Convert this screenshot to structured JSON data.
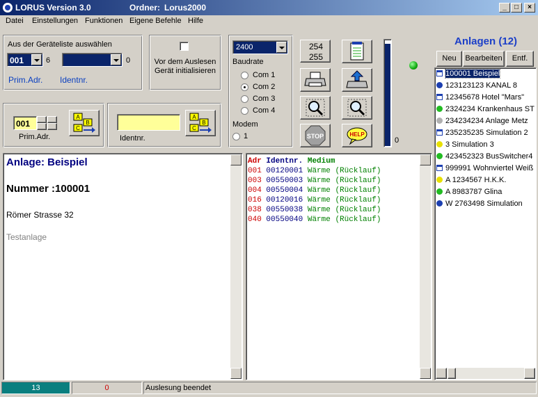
{
  "window": {
    "title": "LORUS Version 3.0",
    "ordner_label": "Ordner:",
    "ordner_value": "Lorus2000"
  },
  "menu": [
    "Datei",
    "Einstellungen",
    "Funktionen",
    "Eigene Befehle",
    "Hilfe"
  ],
  "device_select": {
    "label": "Aus der Geräteliste auswählen",
    "prim_value": "001",
    "prim_count": "6",
    "ident_value": "",
    "ident_count": "0",
    "prim_caption": "Prim.Adr.",
    "ident_caption": "Identnr."
  },
  "init_box": {
    "label": "Vor dem Auslesen Gerät initialisieren",
    "checked": false
  },
  "baud": {
    "value": "2400",
    "label": "Baudrate",
    "ports": [
      "Com 1",
      "Com 2",
      "Com 3",
      "Com 4"
    ],
    "selected_port": "Com 2",
    "modem_label": "Modem",
    "modem_option": "1"
  },
  "address_buttons": {
    "b254": "254",
    "b255": "255"
  },
  "progress": {
    "value": "0",
    "fraction": 0.97
  },
  "prim_entry": {
    "value": "001",
    "caption": "Prim.Adr."
  },
  "ident_entry": {
    "value": "",
    "caption": "Identnr."
  },
  "anlagen": {
    "title": "Anlagen (12)",
    "buttons": [
      "Neu",
      "Bearbeiten",
      "Entf."
    ],
    "items": [
      {
        "icon": "building",
        "color": "#1c3fb0",
        "text": "100001  Beispiel",
        "selected": true
      },
      {
        "icon": "dot",
        "color": "#1c3fb0",
        "text": "123123123  KANAL 8"
      },
      {
        "icon": "building",
        "color": "#1c3fb0",
        "text": "12345678  Hotel \"Mars\""
      },
      {
        "icon": "dot",
        "color": "#22bb22",
        "text": "2324234  Krankenhaus ST"
      },
      {
        "icon": "dot",
        "color": "#b0b0b0",
        "text": "234234234  Anlage Metz"
      },
      {
        "icon": "building",
        "color": "#1c3fb0",
        "text": "235235235  Simulation 2"
      },
      {
        "icon": "dot",
        "color": "#e8e000",
        "text": "3  Simulation 3"
      },
      {
        "icon": "dot",
        "color": "#22bb22",
        "text": "423452323  BusSwitcher4"
      },
      {
        "icon": "building",
        "color": "#1c3fb0",
        "text": "999991  Wohnviertel Weiß"
      },
      {
        "icon": "dot",
        "color": "#e8e000",
        "text": "A 1234567  H.K.K."
      },
      {
        "icon": "dot",
        "color": "#22bb22",
        "text": "A 8983787  Glina"
      },
      {
        "icon": "dot",
        "color": "#1c3fb0",
        "text": "W 2763498  Simulation"
      }
    ]
  },
  "info": {
    "anlage": "Anlage: Beispiel",
    "nummer": "Nummer :100001",
    "strasse": "Römer Strasse 32",
    "beschreibung": "Testanlage"
  },
  "devices": {
    "headers": {
      "adr": "Adr",
      "ident": "Identnr.",
      "medium": "Medium"
    },
    "rows": [
      {
        "adr": "001",
        "ident": "00120001",
        "medium": "Wärme (Rücklauf)"
      },
      {
        "adr": "003",
        "ident": "00550003",
        "medium": "Wärme (Rücklauf)"
      },
      {
        "adr": "004",
        "ident": "00550004",
        "medium": "Wärme (Rücklauf)"
      },
      {
        "adr": "016",
        "ident": "00120016",
        "medium": "Wärme (Rücklauf)"
      },
      {
        "adr": "038",
        "ident": "00550038",
        "medium": "Wärme (Rücklauf)"
      },
      {
        "adr": "040",
        "ident": "00550040",
        "medium": "Wärme (Rücklauf)"
      }
    ]
  },
  "status": {
    "count": "13",
    "errors": "0",
    "message": "Auslesung beendet"
  },
  "colors": {
    "accent": "#0a246a",
    "status_green": "#22bb22",
    "adr_red": "#cc0000",
    "ident_navy": "#000080",
    "medium_green": "#008000"
  }
}
